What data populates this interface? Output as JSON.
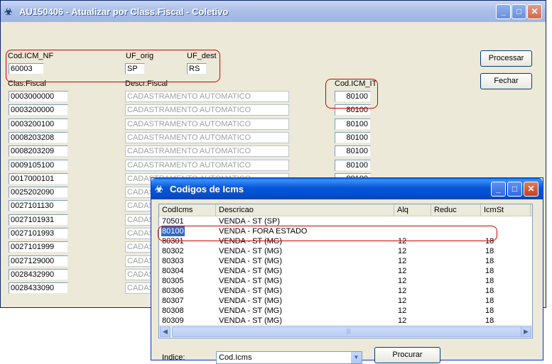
{
  "main_window": {
    "title": "AU150406 - Atualizar por Class.Fiscal - Coletivo",
    "labels": {
      "cod_icm_nf": "Cod.ICM_NF",
      "uf_orig": "UF_orig",
      "uf_dest": "UF_dest",
      "clas_fiscal": "Clas.Fiscal",
      "descr_fiscal": "Descr.Fiscal",
      "cod_icm_it": "Cod.ICM_IT"
    },
    "values": {
      "cod_icm_nf": "60003",
      "uf_orig": "SP",
      "uf_dest": "RS"
    },
    "buttons": {
      "processar": "Processar",
      "fechar": "Fechar"
    },
    "rows": [
      {
        "clas": "0003000000",
        "descr": "CADASTRAMENTO AUTOMATICO",
        "icm": "80100"
      },
      {
        "clas": "0003200000",
        "descr": "CADASTRAMENTO AUTOMATICO",
        "icm": "80100"
      },
      {
        "clas": "0003200100",
        "descr": "CADASTRAMENTO AUTOMATICO",
        "icm": "80100"
      },
      {
        "clas": "0008203208",
        "descr": "CADASTRAMENTO AUTOMATICO",
        "icm": "80100"
      },
      {
        "clas": "0008203209",
        "descr": "CADASTRAMENTO AUTOMATICO",
        "icm": "80100"
      },
      {
        "clas": "0009105100",
        "descr": "CADASTRAMENTO AUTOMATICO",
        "icm": "80100"
      },
      {
        "clas": "0017000101",
        "descr": "CADASTRAMENTO AUTOMATICO",
        "icm": "80100"
      },
      {
        "clas": "0025202090",
        "descr": "CADAS",
        "icm": ""
      },
      {
        "clas": "0027101130",
        "descr": "CADAS",
        "icm": ""
      },
      {
        "clas": "0027101931",
        "descr": "CADAS",
        "icm": ""
      },
      {
        "clas": "0027101993",
        "descr": "CADAS",
        "icm": ""
      },
      {
        "clas": "0027101999",
        "descr": "CADAS",
        "icm": ""
      },
      {
        "clas": "0027129000",
        "descr": "CADAS",
        "icm": ""
      },
      {
        "clas": "0028432990",
        "descr": "CADAS",
        "icm": ""
      },
      {
        "clas": "0028433090",
        "descr": "CADAS",
        "icm": ""
      }
    ]
  },
  "dialog": {
    "title": "Codigos de Icms",
    "columns": [
      "CodIcms",
      "Descricao",
      "Alq",
      "Reduc",
      "IcmSt"
    ],
    "rows": [
      {
        "cod": "70501",
        "desc": "VENDA - ST (SP)",
        "alq": "",
        "reduc": "",
        "st": ""
      },
      {
        "cod": "80100",
        "desc": "VENDA -  FORA ESTADO",
        "alq": "",
        "reduc": "",
        "st": ""
      },
      {
        "cod": "80301",
        "desc": "VENDA - ST (MG)",
        "alq": "12",
        "reduc": "",
        "st": "18"
      },
      {
        "cod": "80302",
        "desc": "VENDA - ST (MG)",
        "alq": "12",
        "reduc": "",
        "st": "18"
      },
      {
        "cod": "80303",
        "desc": "VENDA - ST (MG)",
        "alq": "12",
        "reduc": "",
        "st": "18"
      },
      {
        "cod": "80304",
        "desc": "VENDA - ST (MG)",
        "alq": "12",
        "reduc": "",
        "st": "18"
      },
      {
        "cod": "80305",
        "desc": "VENDA - ST (MG)",
        "alq": "12",
        "reduc": "",
        "st": "18"
      },
      {
        "cod": "80306",
        "desc": "VENDA - ST (MG)",
        "alq": "12",
        "reduc": "",
        "st": "18"
      },
      {
        "cod": "80307",
        "desc": "VENDA - ST (MG)",
        "alq": "12",
        "reduc": "",
        "st": "18"
      },
      {
        "cod": "80308",
        "desc": "VENDA - ST (MG)",
        "alq": "12",
        "reduc": "",
        "st": "18"
      },
      {
        "cod": "80309",
        "desc": "VENDA - ST (MG)",
        "alq": "12",
        "reduc": "",
        "st": "18"
      }
    ],
    "selected_code": "80100",
    "indice_label": "Indice:",
    "indice_value": "Cod.Icms",
    "procurar": "Procurar"
  },
  "colors": {
    "highlight": "#316ac5",
    "annotation": "#d00000"
  }
}
